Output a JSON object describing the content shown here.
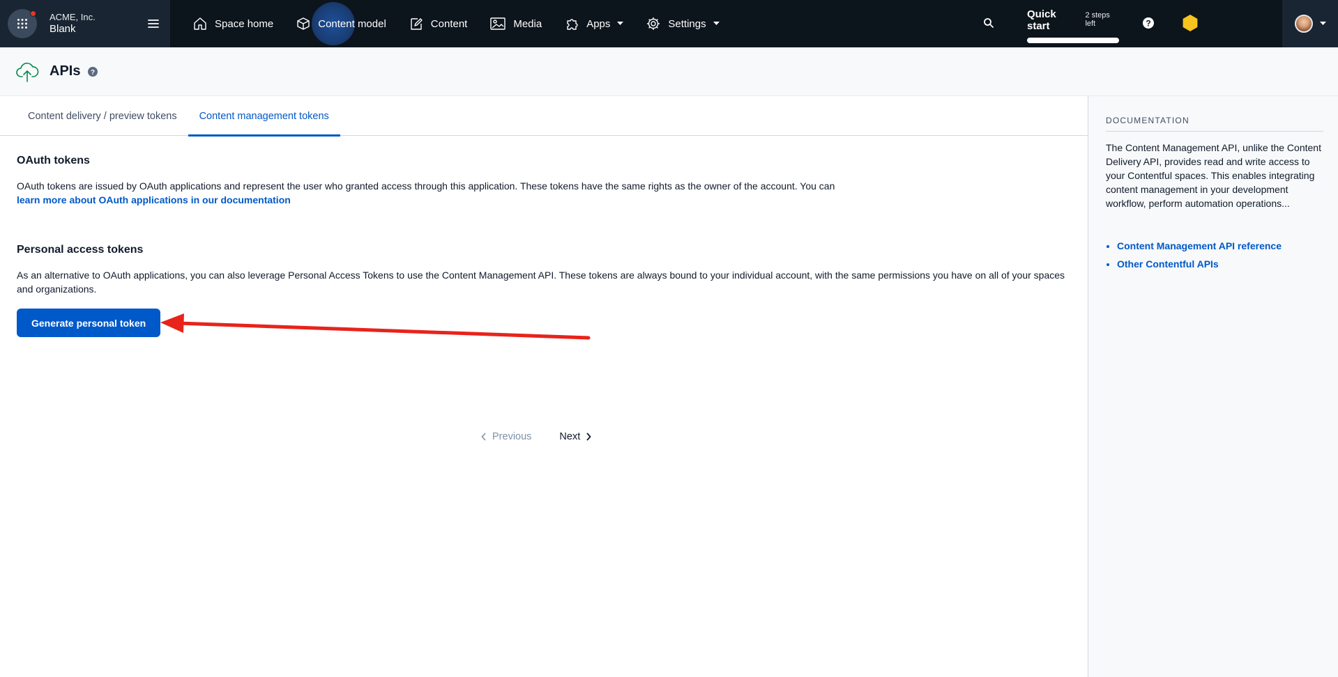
{
  "topbar": {
    "org_name": "ACME, Inc.",
    "environment": "Blank",
    "nav": [
      {
        "label": "Space home",
        "icon": "home-icon"
      },
      {
        "label": "Content model",
        "icon": "cube-icon"
      },
      {
        "label": "Content",
        "icon": "edit-icon"
      },
      {
        "label": "Media",
        "icon": "image-icon"
      },
      {
        "label": "Apps",
        "icon": "puzzle-icon"
      },
      {
        "label": "Settings",
        "icon": "gear-icon"
      }
    ],
    "quick_start": {
      "title": "Quick start",
      "subtitle": "2 steps left"
    },
    "accent_dot_color": "#e5352a",
    "hex_color": "#f7c31f"
  },
  "page": {
    "title": "APIs"
  },
  "tabs": [
    {
      "label": "Content delivery / preview tokens",
      "active": false
    },
    {
      "label": "Content management tokens",
      "active": true
    }
  ],
  "oauth": {
    "title": "OAuth tokens",
    "text": "OAuth tokens are issued by OAuth applications and represent the user who granted access through this application. These tokens have the same rights as the owner of the account. You can",
    "link": "learn more about OAuth applications in our documentation"
  },
  "pat": {
    "title": "Personal access tokens",
    "text": "As an alternative to OAuth applications, you can also leverage Personal Access Tokens to use the Content Management API. These tokens are always bound to your individual account, with the same permissions you have on all of your spaces and organizations.",
    "button": "Generate personal token"
  },
  "annotation": {
    "arrow_color": "#e8231b"
  },
  "pagination": {
    "previous": "Previous",
    "next": "Next"
  },
  "sidebar": {
    "label": "DOCUMENTATION",
    "text": "The Content Management API, unlike the Content Delivery API, provides read and write access to your Contentful spaces. This enables integrating content management in your development workflow, perform automation operations...",
    "links": [
      "Content Management API reference",
      "Other Contentful APIs"
    ]
  },
  "colors": {
    "accent": "#0059c8",
    "nav_bg": "#0c141c",
    "brand_green": "#0a8a4a"
  }
}
